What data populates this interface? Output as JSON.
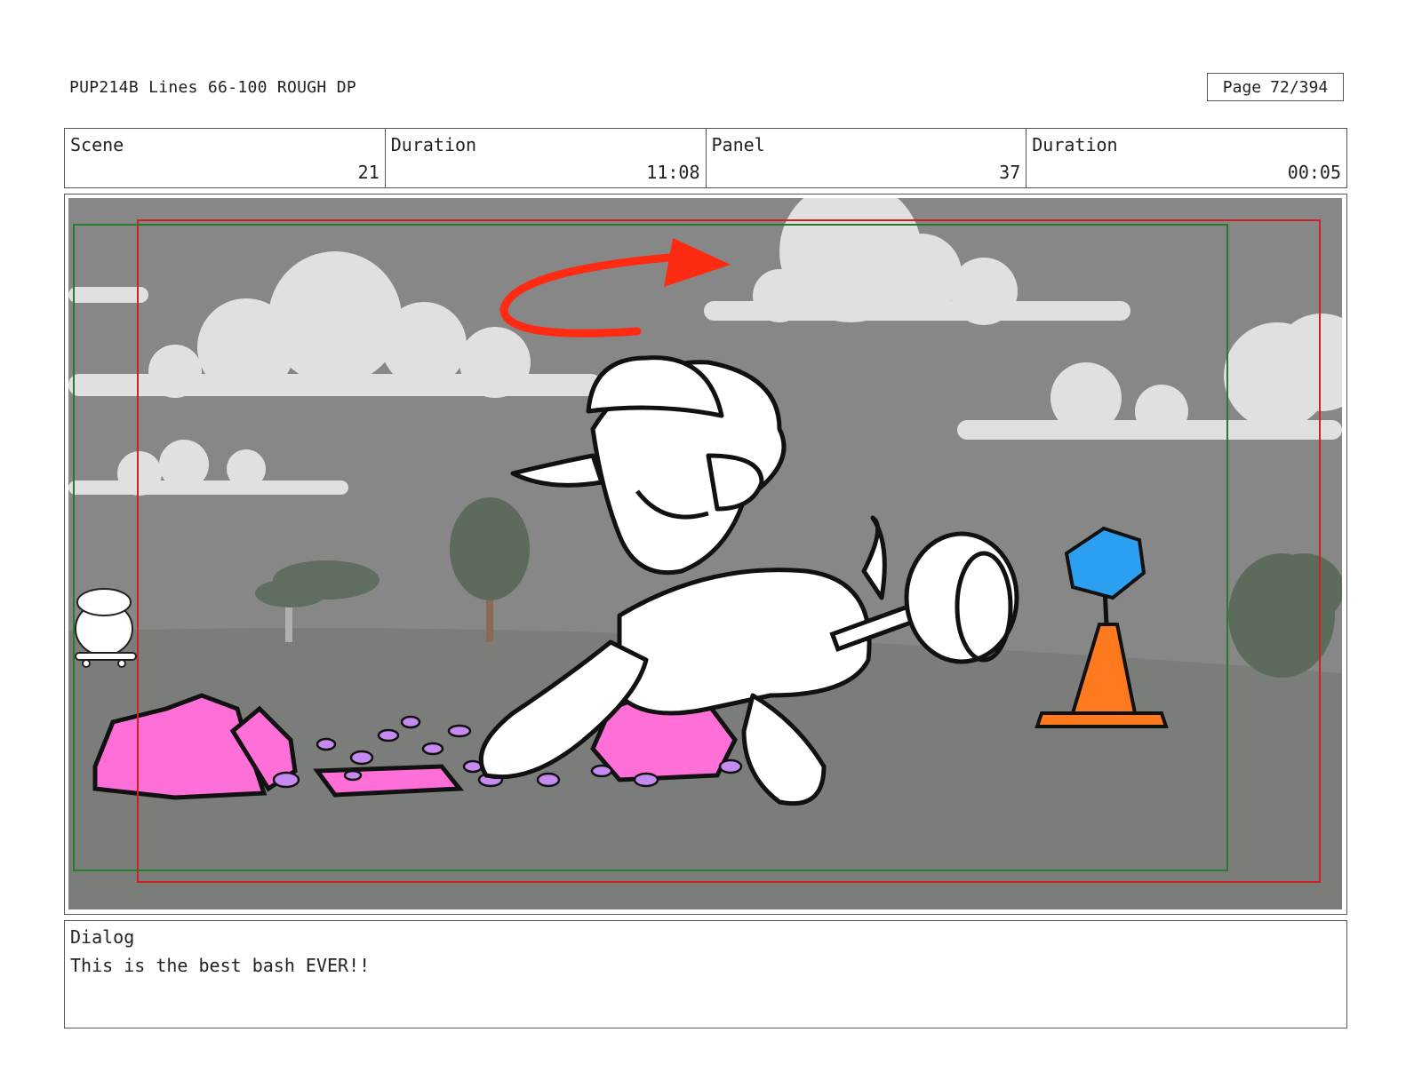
{
  "header": {
    "doc_title": "PUP214B Lines 66-100 ROUGH DP",
    "page_label": "Page",
    "page_number": "72/394"
  },
  "info": [
    {
      "label": "Scene",
      "value": "21"
    },
    {
      "label": "Duration",
      "value": "11:08"
    },
    {
      "label": "Panel",
      "value": "37"
    },
    {
      "label": "Duration",
      "value": "00:05"
    }
  ],
  "dialog": {
    "label": "Dialog",
    "text": "This is the best bash EVER!!"
  },
  "colors": {
    "sky": "#878787",
    "ground": "#7b7d7b",
    "cloud": "#e0e0e0",
    "rock_pink": "#ff6fd8",
    "debris_purple": "#c58bf0",
    "arrow_red": "#ff2a12",
    "cone_orange": "#ff7a1f",
    "hexagon_blue": "#2d9ff0",
    "safe_frame_red": "#cc2222",
    "safe_frame_green": "#2a7a2a"
  }
}
